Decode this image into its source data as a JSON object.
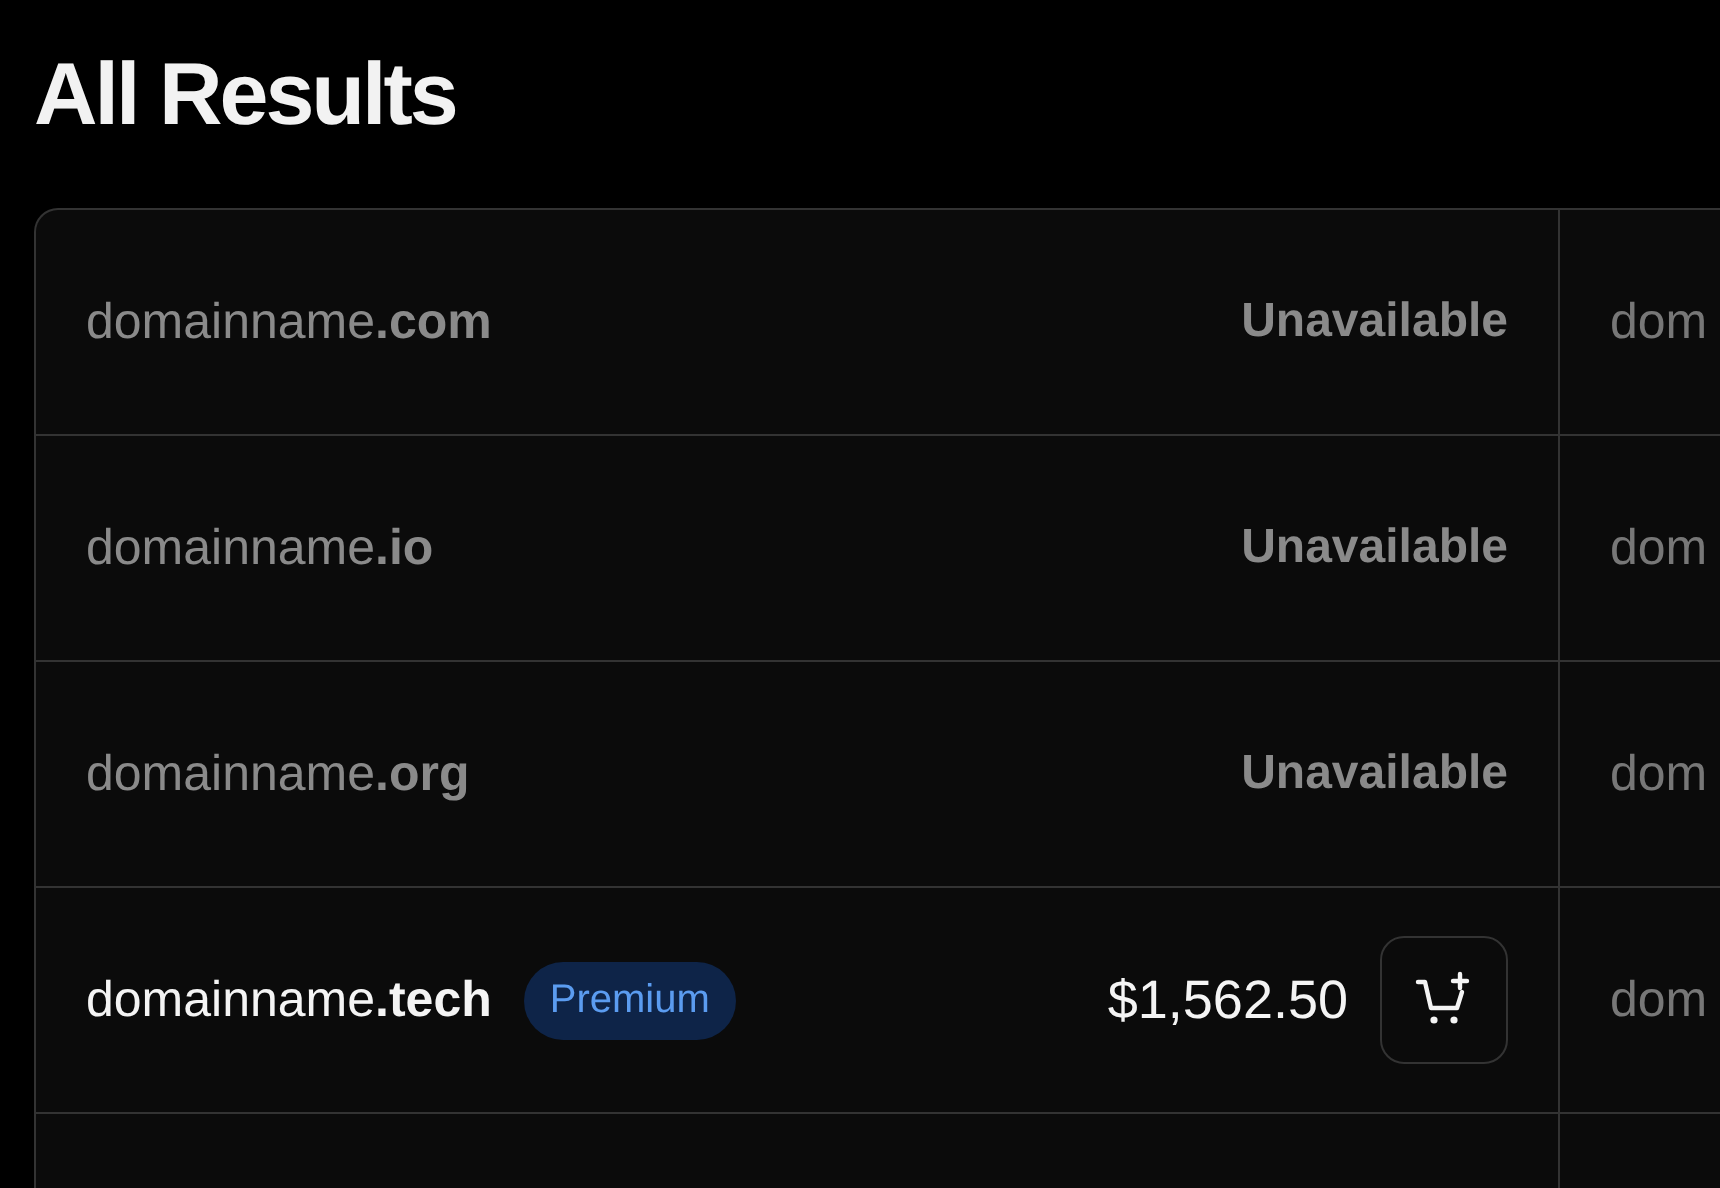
{
  "title": "All Results",
  "results": [
    {
      "domain": "domainname**.com**",
      "available": false,
      "status": "Unavailable",
      "column_2": "dom"
    },
    {
      "domain": "domainname**.io**",
      "available": false,
      "status": "Unavailable",
      "column_2": "dom"
    },
    {
      "domain": "domainname**.org**",
      "available": false,
      "status": "Unavailable",
      "column_2": "dom"
    },
    {
      "domain": "domainname**.tech**",
      "available": true,
      "badge": "Premium",
      "price": "$1,562.50",
      "column_2": "dom"
    }
  ]
}
